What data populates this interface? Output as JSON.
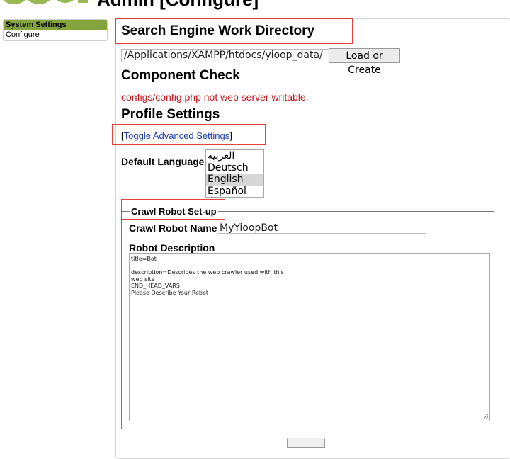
{
  "header": {
    "title": "Admin [Configure]"
  },
  "menu": {
    "heading": "System Settings",
    "items": [
      {
        "label": "Configure"
      }
    ]
  },
  "work_directory": {
    "heading": "Search Engine Work Directory",
    "path_value": "/Applications/XAMPP/htdocs/yioop_data/",
    "load_button_label": "Load or Create"
  },
  "component_check": {
    "heading": "Component Check",
    "warning": "configs/config.php not web server writable."
  },
  "profile": {
    "heading": "Profile Settings",
    "toggle_prefix": "[",
    "toggle_link": "Toggle Advanced Settings",
    "toggle_suffix": "]",
    "language_label": "Default Language:",
    "languages": [
      {
        "label": "العربية",
        "selected": false
      },
      {
        "label": "Deutsch",
        "selected": false
      },
      {
        "label": "English",
        "selected": true
      },
      {
        "label": "Español",
        "selected": false
      }
    ]
  },
  "crawl_robot": {
    "legend": "Crawl Robot Set-up",
    "name_label": "Crawl Robot Name:",
    "name_value": "MyYioopBot",
    "description_label": "Robot Description",
    "description_value": "title=Bot\n\ndescription=Describes the web crawler used with this\nweb site\nEND_HEAD_VARS\nPlease Describe Your Robot"
  },
  "colors": {
    "menu_header": "#86a43e",
    "warning_text": "#c8161d",
    "annotation_box": "#e0443c",
    "link": "#1a3ab0"
  }
}
